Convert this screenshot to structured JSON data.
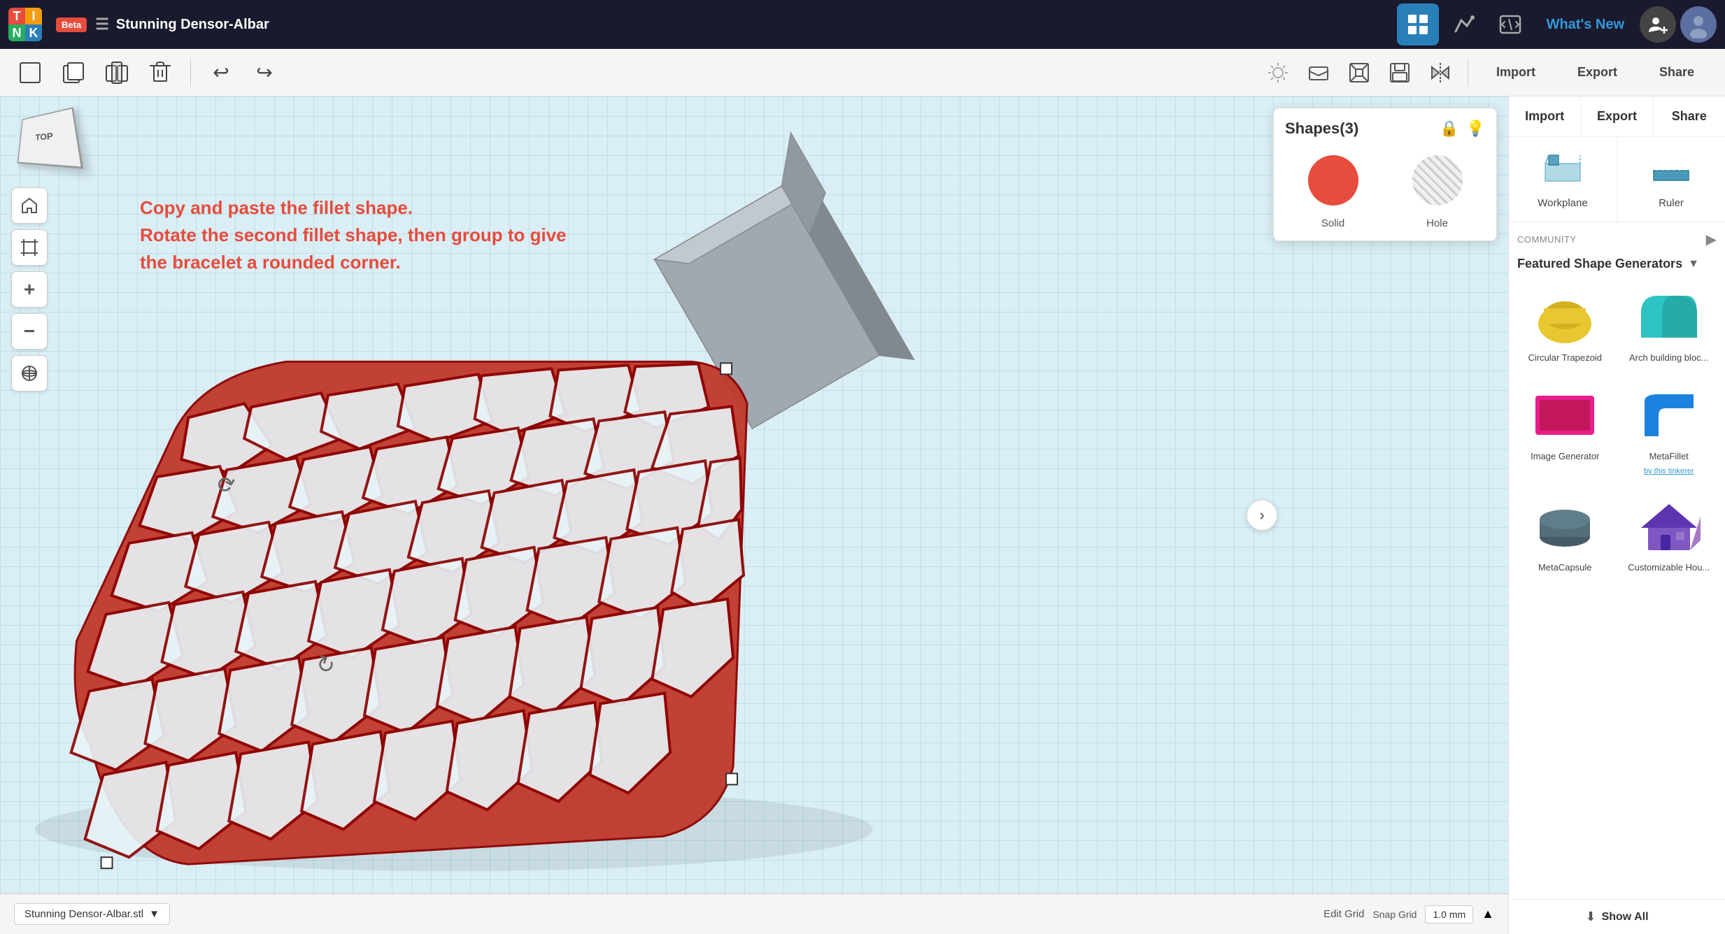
{
  "app": {
    "logo": {
      "letters": [
        "T",
        "I",
        "N",
        "K"
      ]
    },
    "beta_label": "Beta",
    "title": "Stunning Densor-Albar",
    "whats_new": "What's New"
  },
  "toolbar": {
    "import_label": "Import",
    "export_label": "Export",
    "share_label": "Share"
  },
  "canvas": {
    "instruction_line1": "Copy and paste the fillet shape.",
    "instruction_line2": "Rotate the second fillet shape, then group to give",
    "instruction_line3": "the bracelet a rounded corner.",
    "edit_grid_label": "Edit Grid",
    "snap_grid_label": "Snap Grid",
    "snap_grid_value": "1.0 mm"
  },
  "shapes_panel": {
    "title": "Shapes(3)",
    "solid_label": "Solid",
    "hole_label": "Hole"
  },
  "right_panel": {
    "import_label": "Import",
    "export_label": "Export",
    "share_label": "Share",
    "workplane_label": "Workplane",
    "ruler_label": "Ruler",
    "community_label": "Community",
    "featured_label": "Featured Shape Generators",
    "shapes": [
      {
        "name": "Circular Trapezoid",
        "sublabel": "",
        "color": "#e8c832",
        "shape": "circular-trapezoid"
      },
      {
        "name": "Arch building bloc...",
        "sublabel": "",
        "color": "#2ec4c4",
        "shape": "arch"
      },
      {
        "name": "Image Generator",
        "sublabel": "",
        "color": "#e91e8c",
        "shape": "image-gen"
      },
      {
        "name": "MetaFillet",
        "sublabel": "by this tinkerer",
        "color": "#2196f3",
        "shape": "metafillet"
      },
      {
        "name": "MetaCapsule",
        "sublabel": "",
        "color": "#607d8b",
        "shape": "metacapsule"
      },
      {
        "name": "Customizable Hou...",
        "sublabel": "",
        "color": "#7e57c2",
        "shape": "house"
      }
    ],
    "show_all_label": "Show All"
  },
  "bottom_bar": {
    "filename": "Stunning Densor-Albar.stl"
  }
}
